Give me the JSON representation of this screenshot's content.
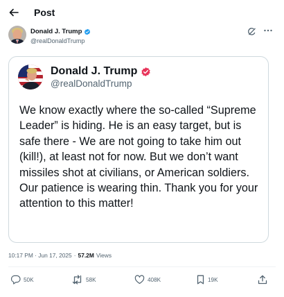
{
  "header": {
    "title": "Post"
  },
  "author": {
    "name": "Donald J. Trump",
    "handle": "@realDonaldTrump"
  },
  "quoted_post": {
    "name": "Donald J. Trump",
    "handle": "@realDonaldTrump",
    "text": "We know exactly where the so-called “Supreme Leader” is hiding. He is an easy target, but is safe there - We are not going to take him out (kill!), at least not for now. But we don’t want missiles shot at civilians, or American soldiers. Our patience is wearing thin. Thank you for your attention to this matter!"
  },
  "meta": {
    "timestamp": "10:17 PM · Jun 17, 2025",
    "separator": "·",
    "views_count": "57.2M",
    "views_label": "Views"
  },
  "actions": {
    "replies": "50K",
    "reposts": "58K",
    "likes": "408K",
    "bookmarks": "19K"
  },
  "colors": {
    "text_primary": "#0f1419",
    "text_secondary": "#536471",
    "verified_badge": "#1d9bf0",
    "card_border": "#cfd9de"
  },
  "icons": [
    "back-arrow-icon",
    "verified-badge-icon",
    "grok-icon",
    "more-icon",
    "reply-icon",
    "repost-icon",
    "like-icon",
    "bookmark-icon",
    "share-icon"
  ]
}
